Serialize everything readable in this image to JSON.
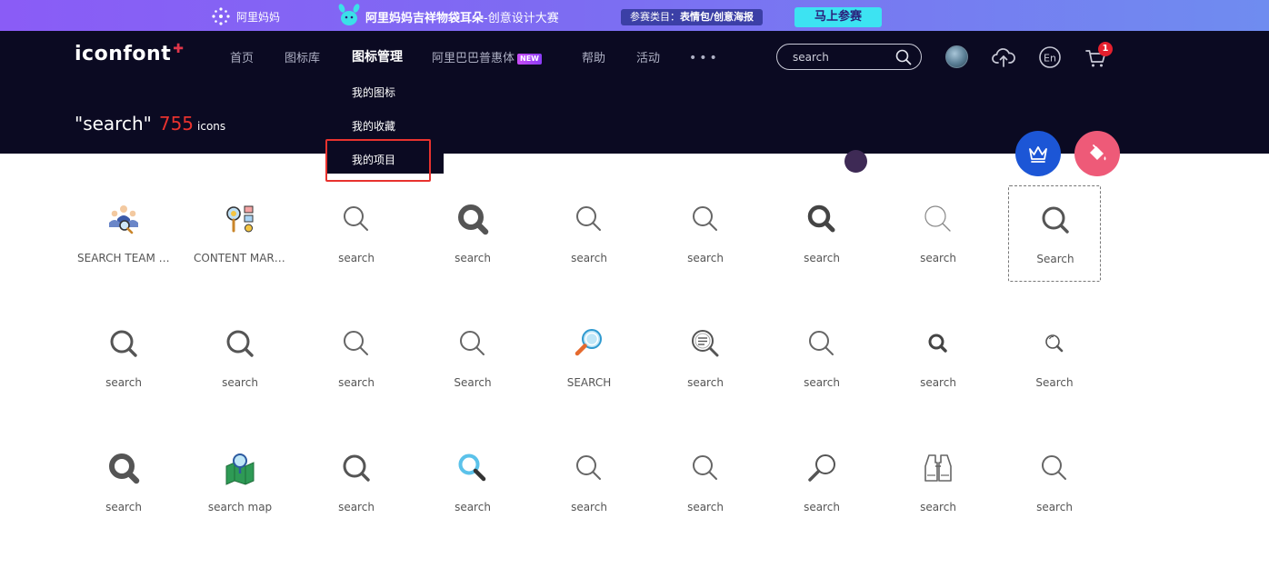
{
  "promo": {
    "brand_label": "阿里妈妈",
    "title": "阿里妈妈吉祥物袋耳朵",
    "title_sub": "-创意设计大赛",
    "category_prefix": "参赛类目：",
    "category_value": "表情包/创意海报",
    "join_label": "马上参赛"
  },
  "header": {
    "logo": "iconfont",
    "nav": {
      "home": "首页",
      "library": "图标库",
      "manage": "图标管理",
      "font": "阿里巴巴普惠体",
      "font_badge": "NEW",
      "help": "帮助",
      "activity": "活动",
      "more": "•••"
    },
    "search_placeholder": "search",
    "cart_count": "1"
  },
  "dropdown": {
    "items": [
      "我的图标",
      "我的收藏",
      "我的项目"
    ]
  },
  "results": {
    "query": "\"search\"",
    "count": "755",
    "unit": "icons"
  },
  "grid": [
    {
      "label": "SEARCH TEAM S...",
      "icon": "search-team-icon"
    },
    {
      "label": "CONTENT MARK...",
      "icon": "content-marketing-icon"
    },
    {
      "label": "search",
      "icon": "search-thin-icon"
    },
    {
      "label": "search",
      "icon": "search-heavy-icon"
    },
    {
      "label": "search",
      "icon": "search-thin-icon"
    },
    {
      "label": "search",
      "icon": "search-thin-icon"
    },
    {
      "label": "search",
      "icon": "search-bold-icon"
    },
    {
      "label": "search",
      "icon": "search-light-icon"
    },
    {
      "label": "Search",
      "icon": "search-medium-icon"
    },
    {
      "label": "search",
      "icon": "search-medium-icon"
    },
    {
      "label": "search",
      "icon": "search-medium-icon"
    },
    {
      "label": "search",
      "icon": "search-thin-icon"
    },
    {
      "label": "Search",
      "icon": "search-thin-icon"
    },
    {
      "label": "SEARCH",
      "icon": "search-colored-icon"
    },
    {
      "label": "search",
      "icon": "search-document-icon"
    },
    {
      "label": "search",
      "icon": "search-thin-icon"
    },
    {
      "label": "search",
      "icon": "search-small-icon"
    },
    {
      "label": "Search",
      "icon": "search-tiny-icon"
    },
    {
      "label": "search",
      "icon": "search-heavy-icon"
    },
    {
      "label": "search map",
      "icon": "search-map-icon"
    },
    {
      "label": "search",
      "icon": "search-medium-icon"
    },
    {
      "label": "search",
      "icon": "search-blue-icon"
    },
    {
      "label": "search",
      "icon": "search-thin-icon"
    },
    {
      "label": "search",
      "icon": "search-thin-icon"
    },
    {
      "label": "search",
      "icon": "magnifier-handle-icon"
    },
    {
      "label": "search",
      "icon": "binoculars-icon"
    },
    {
      "label": "search",
      "icon": "search-thin-icon"
    }
  ]
}
